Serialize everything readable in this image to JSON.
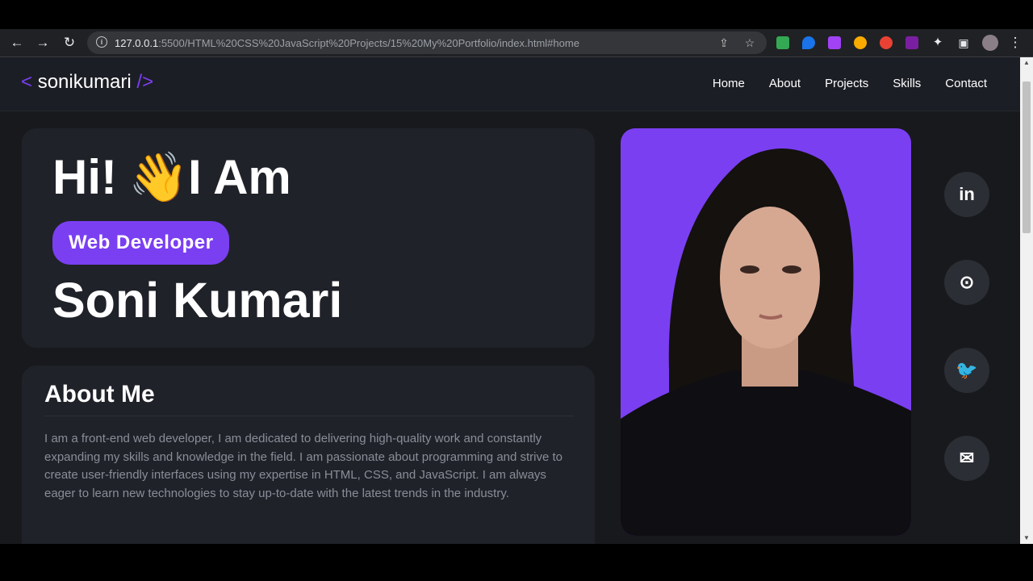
{
  "browser": {
    "url_host": "127.0.0.1",
    "url_path": ":5500/HTML%20CSS%20JavaScript%20Projects/15%20My%20Portfolio/index.html#home",
    "extension_colors": [
      "#34a853",
      "#1a73e8",
      "#a142f4",
      "#f9ab00",
      "#e94235",
      "#7b1fa2"
    ]
  },
  "logo": {
    "open": "<",
    "name": "sonikumari",
    "close": "/>"
  },
  "nav": [
    "Home",
    "About",
    "Projects",
    "Skills",
    "Contact"
  ],
  "hero": {
    "greeting_hi": "Hi!",
    "greeting_emoji": "👋",
    "greeting_rest": "I Am",
    "role": "Web Developer",
    "name": "Soni Kumari"
  },
  "about": {
    "title": "About Me",
    "text": "I am a front-end web developer, I am dedicated to delivering high-quality work and constantly expanding my skills and knowledge in the field. I am passionate about programming and strive to create user-friendly interfaces using my expertise in HTML, CSS, and JavaScript. I am always eager to learn new technologies to stay up-to-date with the latest trends in the industry."
  },
  "social": [
    {
      "icon": "linkedin-icon",
      "glyph": "in"
    },
    {
      "icon": "github-icon",
      "glyph": "⊙"
    },
    {
      "icon": "twitter-icon",
      "glyph": "🐦"
    },
    {
      "icon": "mail-icon",
      "glyph": "✉"
    }
  ],
  "colors": {
    "accent": "#7b3ff2",
    "background": "#18191c",
    "card": "#202229"
  }
}
